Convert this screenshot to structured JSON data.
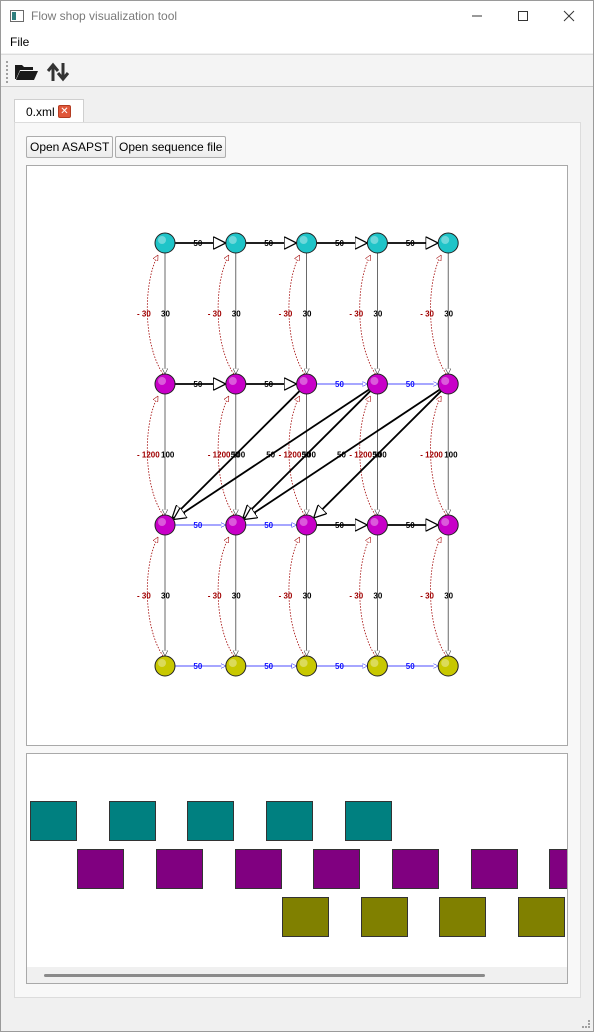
{
  "window": {
    "title": "Flow shop visualization tool",
    "minimize": "—",
    "maximize": "☐",
    "close": "✕"
  },
  "menu": {
    "file": "File"
  },
  "toolbar": {
    "open_icon": "folder-open-icon",
    "sort_icon": "sort-arrows-icon"
  },
  "tab": {
    "label": "0.xml",
    "close_icon": "close-icon"
  },
  "buttons": {
    "open_asapst": "Open ASAPST",
    "open_sequence": "Open sequence file"
  },
  "colors": {
    "node_cyan": "#1fc4c8",
    "node_magenta": "#c800c8",
    "node_yellow": "#c8c800",
    "edge_black": "#000000",
    "edge_blue": "#1010ff",
    "edge_red": "#a00000",
    "gantt_teal": "#008080",
    "gantt_purple": "#800080",
    "gantt_olive": "#808000"
  },
  "graph": {
    "rows": 4,
    "cols": 5,
    "row_colors": [
      "node_cyan",
      "node_magenta",
      "node_magenta",
      "node_yellow"
    ],
    "horizontal_edges": [
      {
        "row": 0,
        "col": 0,
        "label": "50",
        "style": "black"
      },
      {
        "row": 0,
        "col": 1,
        "label": "50",
        "style": "black"
      },
      {
        "row": 0,
        "col": 2,
        "label": "50",
        "style": "black"
      },
      {
        "row": 0,
        "col": 3,
        "label": "50",
        "style": "black"
      },
      {
        "row": 1,
        "col": 0,
        "label": "50",
        "style": "black"
      },
      {
        "row": 1,
        "col": 1,
        "label": "50",
        "style": "black"
      },
      {
        "row": 1,
        "col": 2,
        "label": "50",
        "style": "blue"
      },
      {
        "row": 1,
        "col": 3,
        "label": "50",
        "style": "blue"
      },
      {
        "row": 2,
        "col": 0,
        "label": "50",
        "style": "blue"
      },
      {
        "row": 2,
        "col": 1,
        "label": "50",
        "style": "blue"
      },
      {
        "row": 2,
        "col": 2,
        "label": "50",
        "style": "black"
      },
      {
        "row": 2,
        "col": 3,
        "label": "50",
        "style": "black"
      },
      {
        "row": 3,
        "col": 0,
        "label": "50",
        "style": "blue"
      },
      {
        "row": 3,
        "col": 1,
        "label": "50",
        "style": "blue"
      },
      {
        "row": 3,
        "col": 2,
        "label": "50",
        "style": "blue"
      },
      {
        "row": 3,
        "col": 3,
        "label": "50",
        "style": "blue"
      }
    ],
    "vertical_labels": [
      "30",
      "100",
      "30"
    ],
    "back_labels": [
      "- 30",
      "- 1200",
      "- 30"
    ],
    "diagonal_edges": [
      {
        "from": [
          1,
          2
        ],
        "to": [
          2,
          0
        ],
        "label": "50"
      },
      {
        "from": [
          1,
          3
        ],
        "to": [
          2,
          0
        ],
        "label": "50"
      },
      {
        "from": [
          1,
          3
        ],
        "to": [
          2,
          1
        ],
        "label": "50"
      },
      {
        "from": [
          1,
          4
        ],
        "to": [
          2,
          1
        ],
        "label": "50"
      },
      {
        "from": [
          1,
          4
        ],
        "to": [
          2,
          2
        ],
        "label": "50"
      }
    ]
  },
  "gantt": {
    "rows": [
      {
        "color": "gantt_teal",
        "starts": [
          0,
          1,
          2,
          3,
          4
        ]
      },
      {
        "color": "gantt_purple",
        "starts": [
          0.6,
          1.6,
          2.6,
          3.6,
          4.6,
          5.6,
          6.6
        ]
      },
      {
        "color": "gantt_olive",
        "starts": [
          3.2,
          4.2,
          5.2,
          6.2
        ]
      }
    ]
  }
}
